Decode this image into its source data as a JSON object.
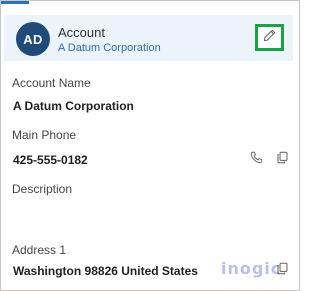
{
  "card": {
    "avatar_initials": "AD",
    "entity_type": "Account",
    "entity_name": "A Datum Corporation",
    "edit_icon": "pencil-icon"
  },
  "fields": {
    "account_name": {
      "label": "Account Name",
      "value": "A Datum Corporation"
    },
    "main_phone": {
      "label": "Main Phone",
      "value": "425-555-0182",
      "actions": [
        "phone-icon",
        "copy-icon"
      ]
    },
    "description": {
      "label": "Description",
      "value": ""
    },
    "address": {
      "label": "Address 1",
      "value": "Washington 98826 United States",
      "actions": [
        "copy-icon"
      ]
    }
  },
  "watermark": "inogic",
  "colors": {
    "accent": "#2f6fb3",
    "avatar": "#1f4a7a",
    "header_bg": "#edf3fb",
    "highlight": "#1f9f4a"
  }
}
